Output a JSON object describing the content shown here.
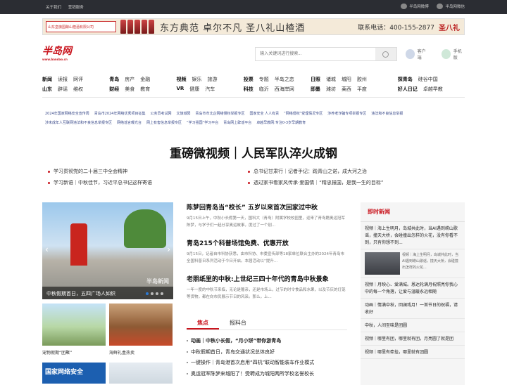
{
  "topbar": {
    "about": "关于我们",
    "ads": "营销服务",
    "weibo": "半岛网微博",
    "wechat": "半岛网微信"
  },
  "ad": {
    "brand": "山东皇旗国酿山楂酒有限公司",
    "slogan": "东方典范 卓尔不凡 圣八礼山楂酒",
    "phone": "联系电话：400-155-2877",
    "logo": "圣八礼"
  },
  "header": {
    "logo": "半岛网",
    "logo_url": "www.bandao.cn",
    "search_placeholder": "输入关键词进行搜索...",
    "client": "客户端",
    "mobile": "手机版"
  },
  "nav": {
    "row1": [
      [
        "新闻",
        "读报",
        "网评"
      ],
      [
        "青岛",
        "房产",
        "金融"
      ],
      [
        "视频",
        "娱乐",
        "旅游"
      ],
      [
        "投票",
        "专题",
        "半岛之恋"
      ],
      [
        "日照",
        "诸城",
        "城阳",
        "胶州"
      ],
      [
        "探青岛",
        "硅谷中国"
      ]
    ],
    "row2": [
      [
        "山东",
        "辟谣",
        "维权"
      ],
      [
        "财经",
        "美食",
        "教育"
      ],
      [
        "VR",
        "健康",
        "汽车"
      ],
      [
        "科技",
        "临沂",
        "西海岸网"
      ],
      [
        "即墨",
        "潍坊",
        "莱西",
        "平度"
      ],
      [
        "好人日记",
        "卓越早教"
      ]
    ]
  },
  "links": [
    "2024年国家网络安全宣传周",
    "青岛市2024年网络优秀项目征集",
    "公务员考试网",
    "文旅城阳",
    "青岛市市北企网络慢权举报专区",
    "国家安全 人人有责",
    "“网络侵权”受理情况专区",
    "涉养老诈骗专项举报专区",
    "违法和不良信息举报",
    "涉未成年人互联网违法和不良信息举报专区",
    "网络谣言曝光台",
    "网上有害信息举报专区",
    "“学习强国”学习平台",
    "青岛网上辟谣平台",
    "卓越早教网:专注0-3岁早期教育"
  ],
  "headline": "重磅微视频｜人民军队淬火成钢",
  "subs_left": [
    "学习贯彻党的二十届三中全会精神",
    "学习新语｜中秋佳节，习近平总书记这样寄语"
  ],
  "subs_right": [
    "总书记甘肃行｜记者手记：践青山之诺，成大河之治",
    "透过家书看家风传承·爱国情｜“精忠报国，是我一生的目标”"
  ],
  "photo": {
    "caption": "中秋假期首日，五四广场人如织",
    "watermark": "半岛新闻"
  },
  "thumbs": [
    "宠物假期“团聚”",
    "海鲜礼盒热卖"
  ],
  "thumb3_text": "国家网络安全",
  "news": [
    {
      "title": "陈梦回青岛当“校长” 五岁以来首次回家过中秋",
      "body": "9月15日上午，中秋小长假第一天，国科大（青岛）附属学校校园里，迎来了青岛籍奥运冠军陈梦，与学子们一起分享奥运故事，度过了一个别..."
    },
    {
      "title": "青岛215个科普场馆免费、优惠开放",
      "body": "9月15日，记者自市科协获悉，由市科协、市委宣传部等18家单位联合主办的2024年青岛市全国科普日系列活动于今日开启。本届活动以“提升..."
    },
    {
      "title": "老照纸里的中秋:上世纪三四十年代的青岛中秋景象",
      "body": "一年一度的中秋节来临，无论是赠亲，还是市场上，过节的时令食品和水果，以及节庆的灯笼等货物，都在向市民展示节日的风采。那么，上..."
    }
  ],
  "tabs": [
    "焦点",
    "报料台"
  ],
  "focus": [
    "动画｜中秋小长假，“月小饼”带你游青岛",
    "中秋假期首日，青岛交通状况总体良好",
    "一键操作｜青岛港首次启用“四机”联动智能装车作业模式",
    "奥运冠军陈梦来城阳了！受聘成为城阳两所学校名誉校长"
  ],
  "side": {
    "title": "即时新闻",
    "items": [
      "视频｜海上生明月，岛城共此时，当AI遇到崂山歌谣，撞天大桥，会碰撞出怎样的火花，没有你看不到，只有你想不到...",
      "视频｜月映心、爱满城。恩达轮满月祝照亮你我心中的每一个角落，让爱与温暖永远相随",
      "动画｜情满中秋，回澜戏月！一首节日的祝福，请收好",
      "中秋，人间至味是团圆",
      "视频｜哪里有团，哪里就有团，月亮圆了就是团",
      "视频｜哪里有牵挂，哪里就有团圆"
    ],
    "img_text": "视频｜海上生明月，岛城共此时，当AI遇到崂山歌谣，撞天大桥，会碰撞出怎样的火花..."
  }
}
